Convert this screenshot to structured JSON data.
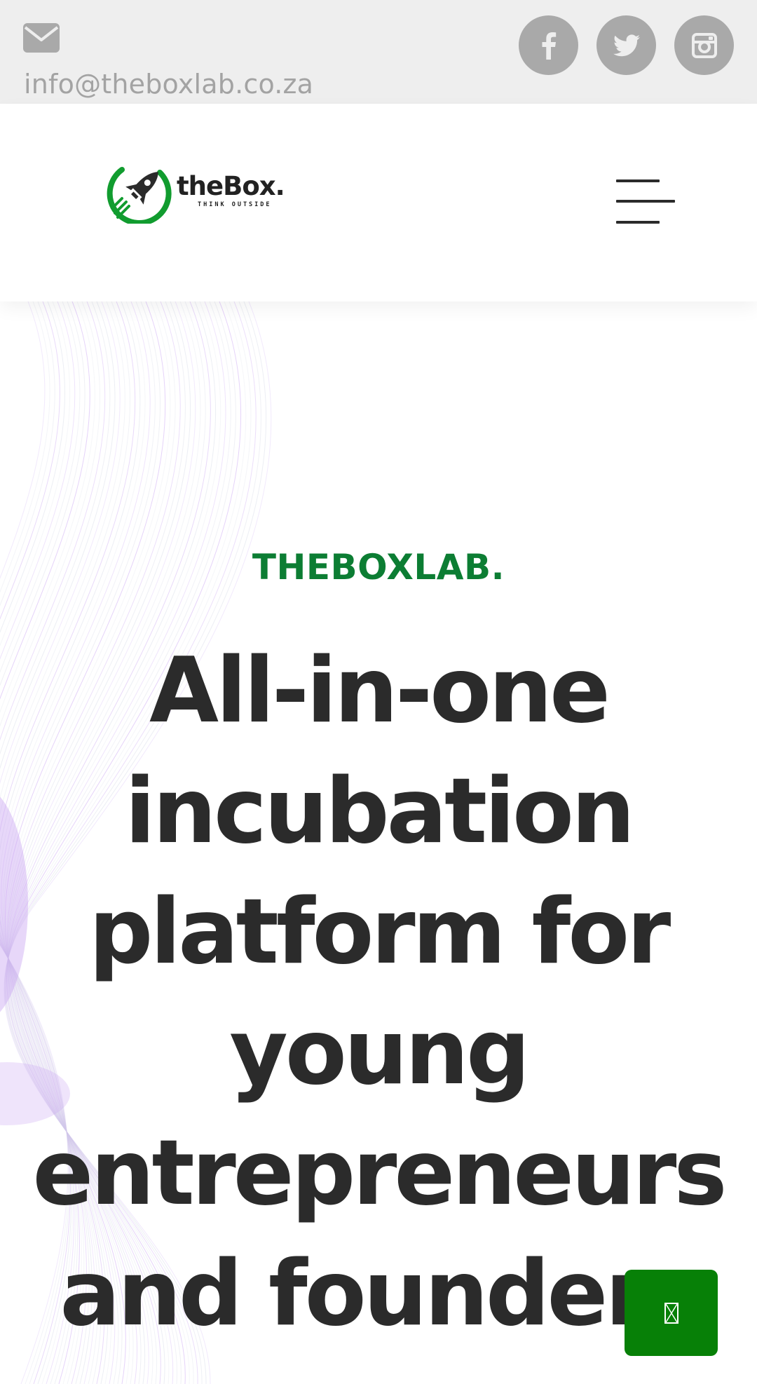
{
  "topbar": {
    "email": "info@theboxlab.co.za",
    "icons": {
      "mail": "envelope-icon",
      "facebook": "facebook-icon",
      "twitter": "twitter-icon",
      "instagram": "instagram-icon"
    },
    "colors": {
      "background": "#eeeeee",
      "icon": "#a9a9a9",
      "text": "#a3a3a3"
    }
  },
  "header": {
    "logo": {
      "wordmark": "theBox.",
      "tagline": "THINK OUTSIDE",
      "icon": "rocket-icon"
    },
    "menu_icon": "hamburger-menu-icon"
  },
  "hero": {
    "eyebrow": "THEBOXLAB.",
    "headline": "All-in-one incubation platform for young entrepreneurs and founders",
    "colors": {
      "eyebrow": "#0c7d33",
      "headline": "#2b2b2b",
      "accent_wave": "#c9a6f2"
    }
  },
  "floating_button": {
    "icon": "chat-icon",
    "color": "#078007"
  }
}
